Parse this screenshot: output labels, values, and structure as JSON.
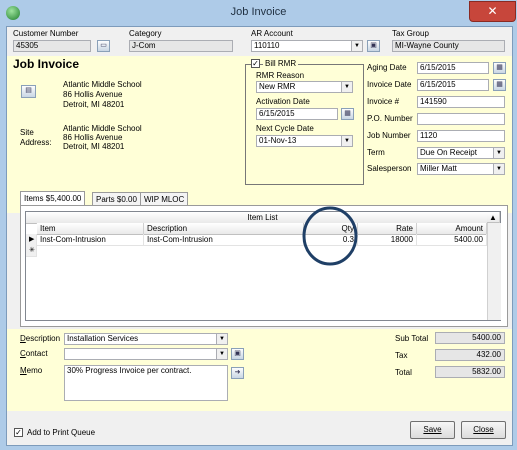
{
  "window": {
    "title": "Job Invoice",
    "close_glyph": "✕"
  },
  "top": {
    "customer_number_label": "Customer Number",
    "customer_number": "45305",
    "category_label": "Category",
    "category": "J-Com",
    "ar_account_label": "AR Account",
    "ar_account": "110110",
    "tax_group_label": "Tax Group",
    "tax_group": "MI-Wayne County"
  },
  "header": {
    "heading": "Job Invoice",
    "bill_to": {
      "name": "Atlantic Middle School",
      "street": "86 Hollis Avenue",
      "city": "Detroit, MI  48201"
    },
    "site_label_1": "Site",
    "site_label_2": "Address:",
    "site": {
      "name": "Atlantic Middle School",
      "street": "86 Hollis Avenue",
      "city": "Detroit, MI  48201"
    }
  },
  "rmr": {
    "bill_rmr_label": "Bill RMR",
    "bill_rmr_checked": true,
    "reason_label": "RMR Reason",
    "reason": "New RMR",
    "activation_label": "Activation Date",
    "activation": "6/15/2015",
    "next_cycle_label": "Next Cycle Date",
    "next_cycle": "01-Nov-13"
  },
  "details": {
    "aging_label": "Aging Date",
    "aging": "6/15/2015",
    "invoice_date_label": "Invoice Date",
    "invoice_date": "6/15/2015",
    "invoice_num_label": "Invoice #",
    "invoice_num": "141590",
    "po_label": "P.O. Number",
    "po": "",
    "job_label": "Job Number",
    "job": "1120",
    "term_label": "Term",
    "term": "Due On Receipt",
    "salesperson_label": "Salesperson",
    "salesperson": "Miller Matt"
  },
  "tabs": [
    {
      "label": "Items  $5,400.00"
    },
    {
      "label": "Parts  $0.00"
    },
    {
      "label": "WIP MLOC"
    }
  ],
  "grid": {
    "caption": "Item List",
    "columns": [
      "Item",
      "Description",
      "Qty",
      "Rate",
      "Amount"
    ],
    "rows": [
      {
        "item": "Inst-Com-Intrusion",
        "description": "Inst-Com-Intrusion",
        "qty": "0.3",
        "rate": "18000",
        "amount": "5400.00"
      }
    ],
    "new_row_marker": "✳"
  },
  "bottom": {
    "description_label": "Description",
    "description": "Installation Services",
    "contact_label": "Contact",
    "contact": "",
    "memo_label": "Memo",
    "memo": "30% Progress Invoice per contract.",
    "subtotal_label": "Sub Total",
    "subtotal": "5400.00",
    "tax_label": "Tax",
    "tax": "432.00",
    "total_label": "Total",
    "total": "5832.00"
  },
  "footer": {
    "print_queue_label": "Add to Print Queue",
    "print_queue_checked": true,
    "save_label": "Save",
    "close_label": "Close"
  },
  "annotation_color": "#1f3f66"
}
